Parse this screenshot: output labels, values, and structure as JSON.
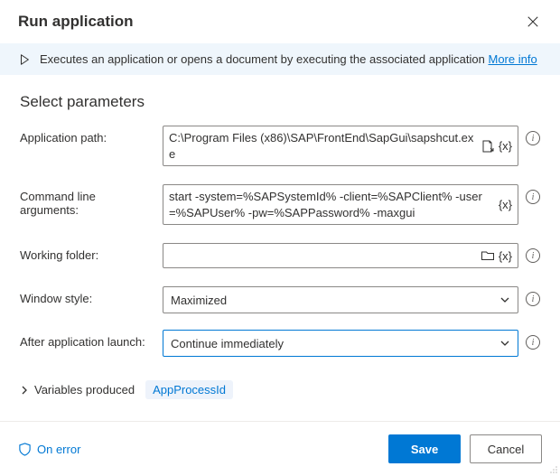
{
  "header": {
    "title": "Run application"
  },
  "info": {
    "text": "Executes an application or opens a document by executing the associated application ",
    "link": "More info"
  },
  "section_title": "Select parameters",
  "fields": {
    "application_path": {
      "label": "Application path:",
      "value": "C:\\Program Files (x86)\\SAP\\FrontEnd\\SapGui\\sapshcut.exe"
    },
    "command_line_arguments": {
      "label": "Command line arguments:",
      "value": "start -system=%SAPSystemId% -client=%SAPClient% -user=%SAPUser% -pw=%SAPPassword% -maxgui"
    },
    "working_folder": {
      "label": "Working folder:",
      "value": ""
    },
    "window_style": {
      "label": "Window style:",
      "value": "Maximized"
    },
    "after_launch": {
      "label": "After application launch:",
      "value": "Continue immediately"
    }
  },
  "variables_produced": {
    "label": "Variables produced",
    "value": "AppProcessId"
  },
  "footer": {
    "on_error": "On error",
    "save": "Save",
    "cancel": "Cancel"
  },
  "var_token": "{x}",
  "info_glyph": "i"
}
